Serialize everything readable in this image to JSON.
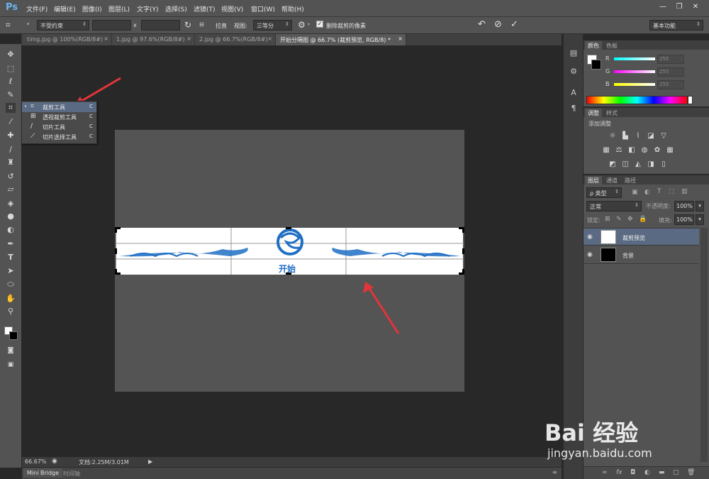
{
  "app": {
    "logo": "Ps"
  },
  "menu": [
    "文件(F)",
    "编辑(E)",
    "图像(I)",
    "图层(L)",
    "文字(Y)",
    "选择(S)",
    "滤镜(T)",
    "视图(V)",
    "窗口(W)",
    "帮助(H)"
  ],
  "window_controls": {
    "minimize": "—",
    "restore": "❐",
    "close": "✕"
  },
  "options": {
    "ratio_preset": "不受约束",
    "x_sep": "x",
    "straighten_label": "拉直",
    "view_label": "视图:",
    "view_value": "三等分",
    "delete_cropped_label": "删除裁剪的像素",
    "delete_cropped_checked": true,
    "workspace": "基本功能"
  },
  "tabs": [
    {
      "label": "timg.jpg @ 100%(RGB/8#)",
      "close": "×",
      "active": false
    },
    {
      "label": "1.jpg @ 97.6%(RGB/8#)",
      "close": "×",
      "active": false
    },
    {
      "label": "2.jpg @ 66.7%(RGB/8#)",
      "close": "×",
      "active": false
    },
    {
      "label": "开始分隔图 @ 66.7% (裁剪预览, RGB/8) *",
      "close": "×",
      "active": true
    }
  ],
  "flyout": {
    "items": [
      {
        "label": "裁剪工具",
        "key": "C",
        "selected": true
      },
      {
        "label": "透视裁剪工具",
        "key": "C",
        "selected": false
      },
      {
        "label": "切片工具",
        "key": "C",
        "selected": false
      },
      {
        "label": "切片选择工具",
        "key": "C",
        "selected": false
      }
    ]
  },
  "canvas": {
    "center_text": "开始"
  },
  "status": {
    "zoom": "66.67%",
    "doc_info": "文档:2.25M/3.01M"
  },
  "bottom_tabs": [
    "Mini Bridge",
    "时间轴"
  ],
  "color_panel": {
    "tabs": [
      "颜色",
      "色板"
    ],
    "channels": [
      {
        "label": "R",
        "value": "255"
      },
      {
        "label": "G",
        "value": "255"
      },
      {
        "label": "B",
        "value": "255"
      }
    ]
  },
  "adjust_panel": {
    "tabs": [
      "调整",
      "样式"
    ],
    "title": "添加调整"
  },
  "layers_panel": {
    "tabs": [
      "图层",
      "通道",
      "路径"
    ],
    "filter_label": "ρ 类型",
    "blend_mode": "正常",
    "opacity_label": "不透明度:",
    "opacity_value": "100%",
    "lock_label": "锁定:",
    "fill_label": "填充:",
    "fill_value": "100%",
    "layers": [
      {
        "name": "裁剪预览",
        "selected": true
      },
      {
        "name": "背景",
        "selected": false
      }
    ]
  },
  "watermark": {
    "brand": "Bai 经验",
    "url": "jingyan.baidu.com"
  },
  "colors": {
    "accent_blue": "#1f6fc4",
    "arrow_red": "#e0353a",
    "selected_row": "#5a6a82",
    "ps_blue": "#6cb4f0"
  }
}
